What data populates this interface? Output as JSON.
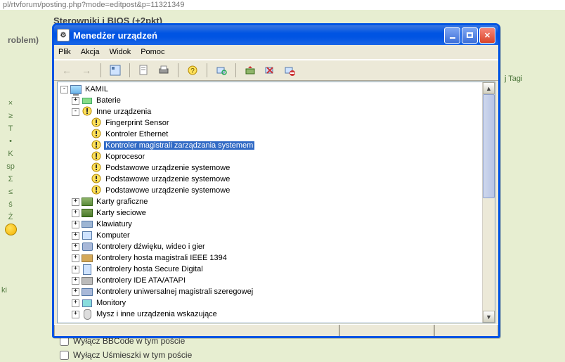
{
  "url_fragment": "pl/rtvforum/posting.php?mode=editpost&p=11321349",
  "breadcrumb": "Sterowniki i BIOS (+2pkt)",
  "side_label": "roblem)",
  "side_tag": "j Tagi",
  "ki_label": "ki",
  "checkbox1_label": "Wyłącz BBCode w tym poście",
  "checkbox2_label": "Wyłącz Uśmieszki w tym poście",
  "symbols": [
    "×",
    "≥",
    "T",
    "•",
    "K",
    "sp",
    "Σ",
    "≤",
    "ś",
    "Ż"
  ],
  "window": {
    "title": "Menedżer urządzeń",
    "menus": [
      "Plik",
      "Akcja",
      "Widok",
      "Pomoc"
    ]
  },
  "tree": {
    "root": "KAMIL",
    "nodes": [
      {
        "indent": 1,
        "exp": "+",
        "icon": "bat",
        "label": "Baterie"
      },
      {
        "indent": 1,
        "exp": "-",
        "icon": "warn",
        "label": "Inne urządzenia"
      },
      {
        "indent": 2,
        "exp": "",
        "icon": "warn",
        "label": "Fingerprint Sensor"
      },
      {
        "indent": 2,
        "exp": "",
        "icon": "warn",
        "label": "Kontroler Ethernet"
      },
      {
        "indent": 2,
        "exp": "",
        "icon": "warn",
        "label": "Kontroler magistrali zarządzania systemem",
        "selected": true
      },
      {
        "indent": 2,
        "exp": "",
        "icon": "warn",
        "label": "Koprocesor"
      },
      {
        "indent": 2,
        "exp": "",
        "icon": "warn",
        "label": "Podstawowe urządzenie systemowe"
      },
      {
        "indent": 2,
        "exp": "",
        "icon": "warn",
        "label": "Podstawowe urządzenie systemowe"
      },
      {
        "indent": 2,
        "exp": "",
        "icon": "warn",
        "label": "Podstawowe urządzenie systemowe"
      },
      {
        "indent": 1,
        "exp": "+",
        "icon": "card",
        "label": "Karty graficzne"
      },
      {
        "indent": 1,
        "exp": "+",
        "icon": "net",
        "label": "Karty sieciowe"
      },
      {
        "indent": 1,
        "exp": "+",
        "icon": "kb",
        "label": "Klawiatury"
      },
      {
        "indent": 1,
        "exp": "+",
        "icon": "comp",
        "label": "Komputer"
      },
      {
        "indent": 1,
        "exp": "+",
        "icon": "snd",
        "label": "Kontrolery dźwięku, wideo i gier"
      },
      {
        "indent": 1,
        "exp": "+",
        "icon": "1394",
        "label": "Kontrolery hosta magistrali IEEE 1394"
      },
      {
        "indent": 1,
        "exp": "+",
        "icon": "sd",
        "label": "Kontrolery hosta Secure Digital"
      },
      {
        "indent": 1,
        "exp": "+",
        "icon": "ide",
        "label": "Kontrolery IDE ATA/ATAPI"
      },
      {
        "indent": 1,
        "exp": "+",
        "icon": "ser",
        "label": "Kontrolery uniwersalnej magistrali szeregowej"
      },
      {
        "indent": 1,
        "exp": "+",
        "icon": "mon",
        "label": "Monitory"
      },
      {
        "indent": 1,
        "exp": "+",
        "icon": "mouse",
        "label": "Mysz i inne urządzenia wskazujące"
      }
    ]
  }
}
